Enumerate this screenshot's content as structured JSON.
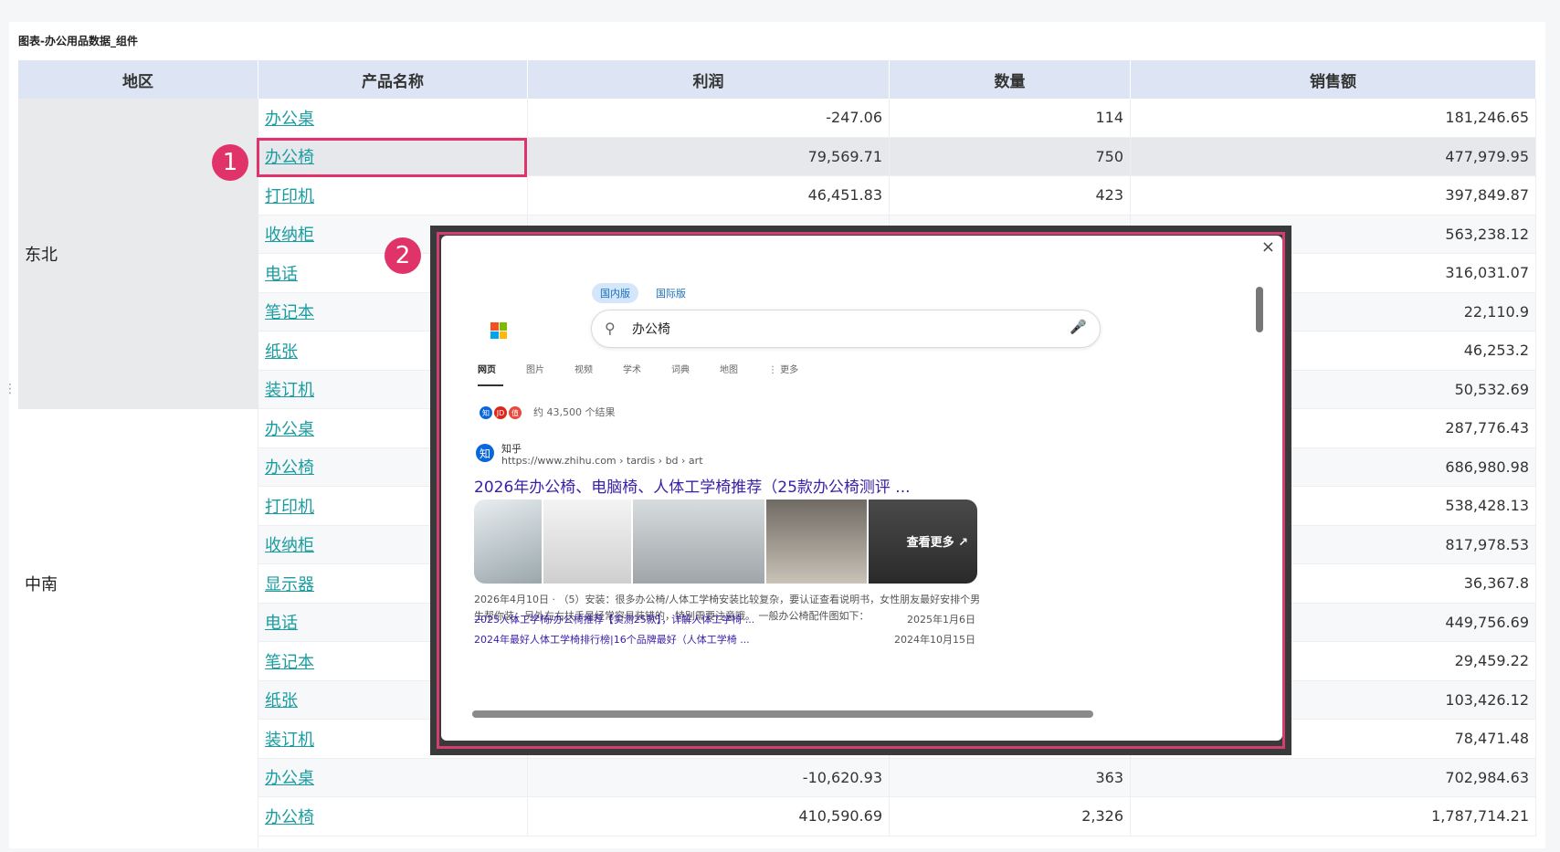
{
  "card_title": "图表-办公用品数据_组件",
  "columns": [
    "地区",
    "产品名称",
    "利润",
    "数量",
    "销售额"
  ],
  "regions": [
    "东北",
    "中南",
    ""
  ],
  "rows": [
    {
      "product": "办公桌",
      "profit": "-247.06",
      "qty": "114",
      "sales": "181,246.65"
    },
    {
      "product": "办公椅",
      "profit": "79,569.71",
      "qty": "750",
      "sales": "477,979.95"
    },
    {
      "product": "打印机",
      "profit": "46,451.83",
      "qty": "423",
      "sales": "397,849.87"
    },
    {
      "product": "收纳柜",
      "profit": "",
      "qty": "",
      "sales": "563,238.12"
    },
    {
      "product": "电话",
      "profit": "",
      "qty": "",
      "sales": "316,031.07"
    },
    {
      "product": "笔记本",
      "profit": "",
      "qty": "",
      "sales": "22,110.9"
    },
    {
      "product": "纸张",
      "profit": "",
      "qty": "",
      "sales": "46,253.2"
    },
    {
      "product": "装订机",
      "profit": "",
      "qty": "",
      "sales": "50,532.69"
    },
    {
      "product": "办公桌",
      "profit": "",
      "qty": "",
      "sales": "287,776.43"
    },
    {
      "product": "办公椅",
      "profit": "",
      "qty": "",
      "sales": "686,980.98"
    },
    {
      "product": "打印机",
      "profit": "",
      "qty": "",
      "sales": "538,428.13"
    },
    {
      "product": "收纳柜",
      "profit": "",
      "qty": "",
      "sales": "817,978.53"
    },
    {
      "product": "显示器",
      "profit": "",
      "qty": "",
      "sales": "36,367.8"
    },
    {
      "product": "电话",
      "profit": "",
      "qty": "",
      "sales": "449,756.69"
    },
    {
      "product": "笔记本",
      "profit": "",
      "qty": "",
      "sales": "29,459.22"
    },
    {
      "product": "纸张",
      "profit": "",
      "qty": "",
      "sales": "103,426.12"
    },
    {
      "product": "装订机",
      "profit": "",
      "qty": "",
      "sales": "78,471.48"
    },
    {
      "product": "办公桌",
      "profit": "-10,620.93",
      "qty": "363",
      "sales": "702,984.63"
    },
    {
      "product": "办公椅",
      "profit": "410,590.69",
      "qty": "2,326",
      "sales": "1,787,714.21"
    }
  ],
  "markers": [
    "1",
    "2"
  ],
  "popup": {
    "close": "×",
    "version_tabs": [
      "国内版",
      "国际版"
    ],
    "query": "办公椅",
    "nav_tabs": [
      "网页",
      "图片",
      "视频",
      "学术",
      "词典",
      "地图",
      "⋮ 更多"
    ],
    "result_count": "约 43,500 个结果",
    "source_icons": [
      "知",
      "JD",
      "值"
    ],
    "site_name": "知乎",
    "site_icon": "知",
    "site_url": "https://www.zhihu.com › tardis › bd › art",
    "result_title": "2026年办公椅、电脑椅、人体工学椅推荐（25款办公椅测评 ...",
    "see_more": "查看更多 ↗",
    "snippet": "2026年4月10日 · （5）安装：很多办公椅/人体工学椅安装比较复杂，要认证查看说明书，女性朋友最好安排个男生帮你装；另外左右扶手是经常容易装错的，特别需要注意哦。 一般办公椅配件图如下：",
    "sublinks": [
      {
        "text": "2025人体工学椅/办公椅推荐【实测25款】，详解人体工学椅 ...",
        "date": "2025年1月6日"
      },
      {
        "text": "2024年最好人体工学椅排行榜|16个品牌最好（人体工学椅 ...",
        "date": "2024年10月15日"
      }
    ]
  },
  "colors": {
    "accent": "#e0336a",
    "link": "#1a9da0",
    "header_bg": "#dde4f3"
  }
}
